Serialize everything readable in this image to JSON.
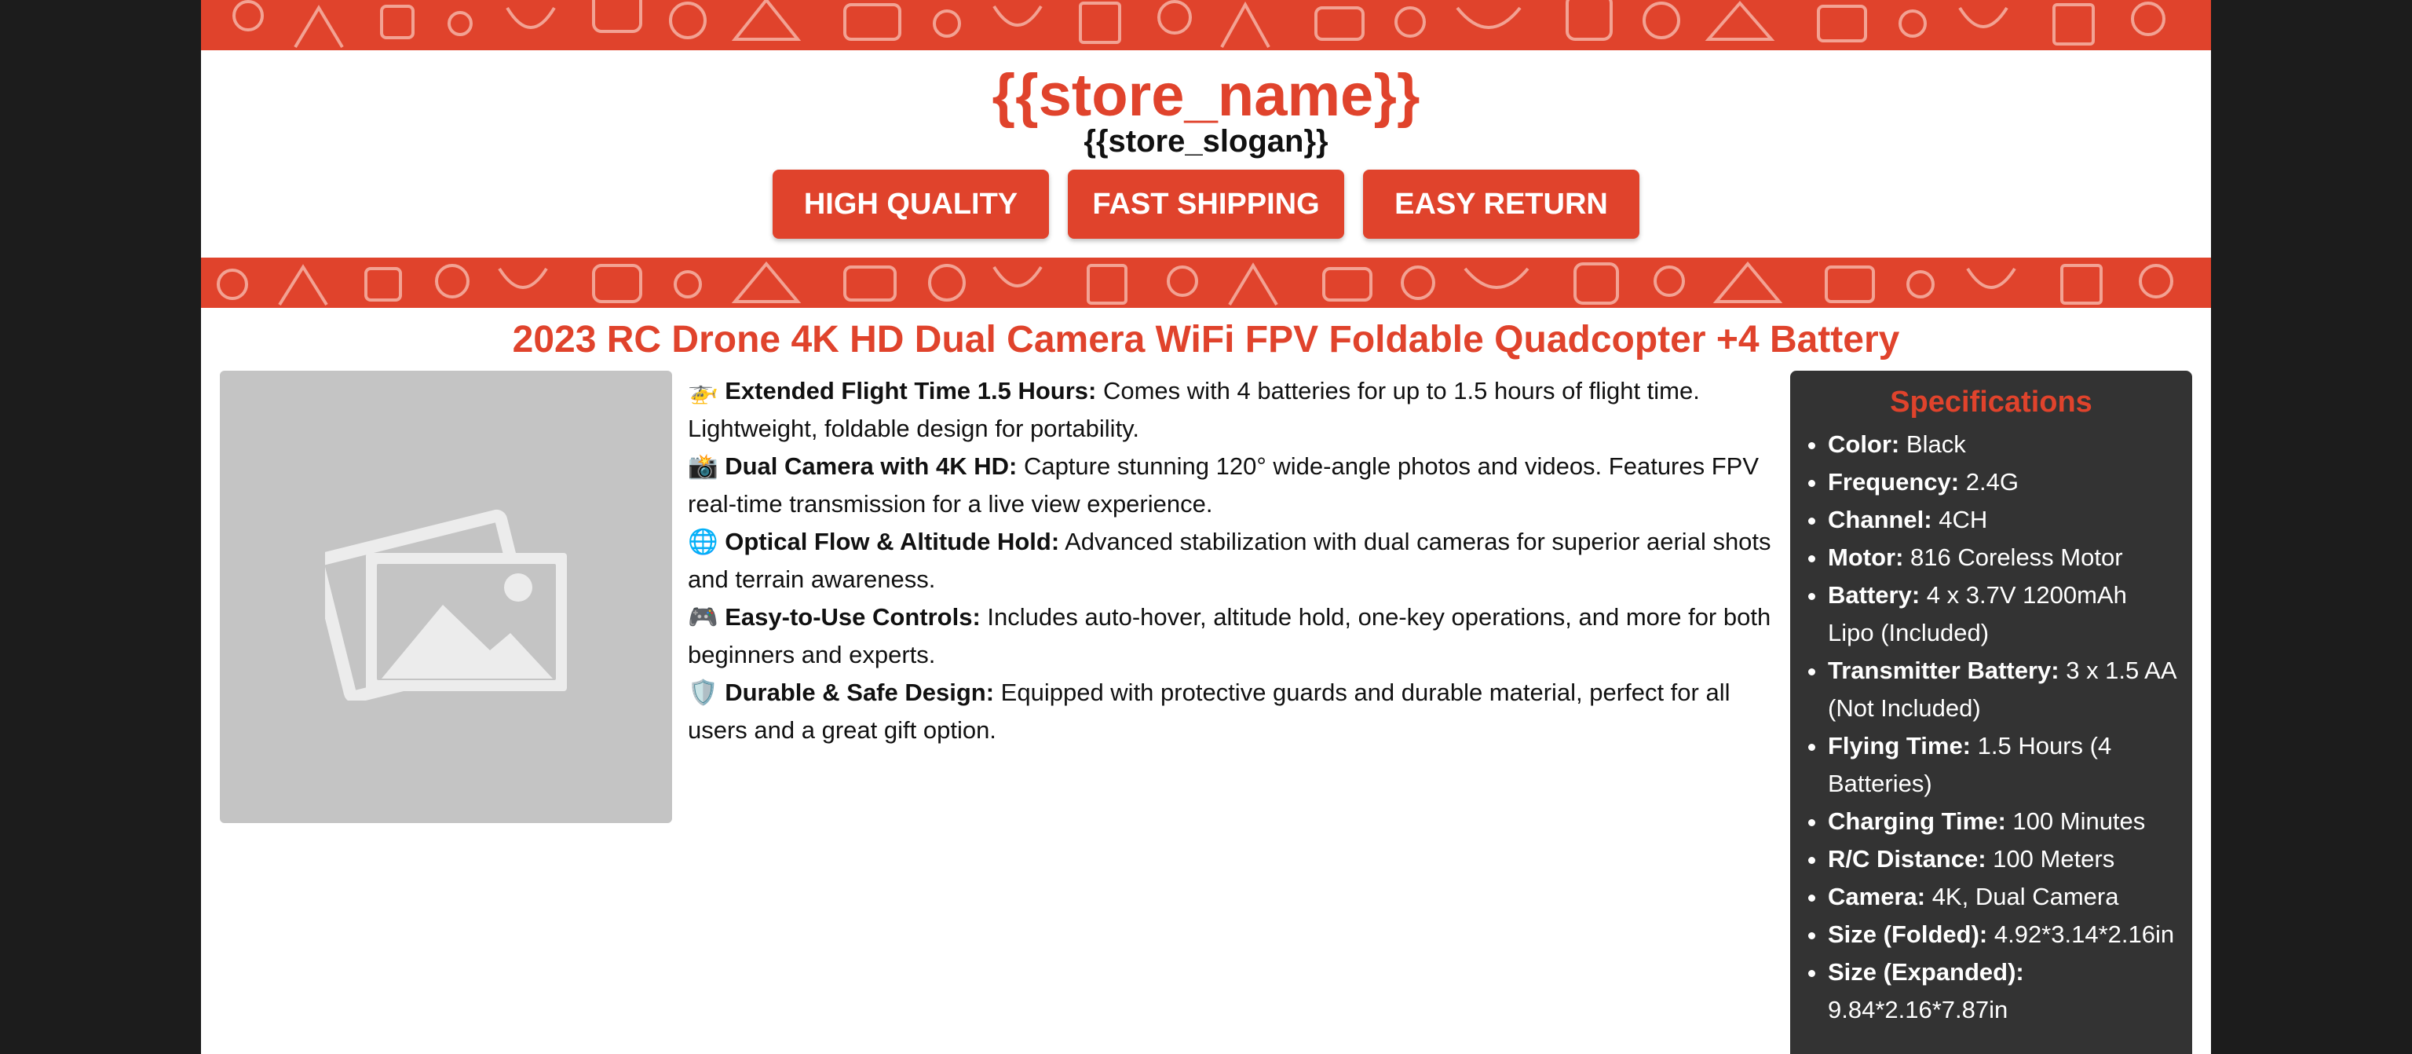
{
  "header": {
    "store_name": "{{store_name}}",
    "store_slogan": "{{store_slogan}}"
  },
  "badges": [
    "HIGH QUALITY",
    "FAST SHIPPING",
    "EASY RETURN"
  ],
  "product": {
    "title": "2023 RC Drone 4K HD Dual Camera WiFi FPV Foldable Quadcopter +4 Battery"
  },
  "features": [
    {
      "icon": "🚁",
      "title": "Extended Flight Time 1.5 Hours:",
      "text": "Comes with 4 batteries for up to 1.5 hours of flight time. Lightweight, foldable design for portability."
    },
    {
      "icon": "📸",
      "title": "Dual Camera with 4K HD:",
      "text": "Capture stunning 120° wide-angle photos and videos. Features FPV real-time transmission for a live view experience."
    },
    {
      "icon": "🌐",
      "title": "Optical Flow & Altitude Hold:",
      "text": "Advanced stabilization with dual cameras for superior aerial shots and terrain awareness."
    },
    {
      "icon": "🎮",
      "title": "Easy-to-Use Controls:",
      "text": "Includes auto-hover, altitude hold, one-key operations, and more for both beginners and experts."
    },
    {
      "icon": "🛡️",
      "title": "Durable & Safe Design:",
      "text": "Equipped with protective guards and durable material, perfect for all users and a great gift option."
    }
  ],
  "specs": {
    "title": "Specifications",
    "items": [
      {
        "label": "Color:",
        "value": "Black"
      },
      {
        "label": "Frequency:",
        "value": "2.4G"
      },
      {
        "label": "Channel:",
        "value": "4CH"
      },
      {
        "label": "Motor:",
        "value": "816 Coreless Motor"
      },
      {
        "label": "Battery:",
        "value": "4 x 3.7V 1200mAh Lipo (Included)"
      },
      {
        "label": "Transmitter Battery:",
        "value": "3 x 1.5 AA (Not Included)"
      },
      {
        "label": "Flying Time:",
        "value": "1.5 Hours (4 Batteries)"
      },
      {
        "label": "Charging Time:",
        "value": "100 Minutes"
      },
      {
        "label": "R/C Distance:",
        "value": "100 Meters"
      },
      {
        "label": "Camera:",
        "value": "4K, Dual Camera"
      },
      {
        "label": "Size (Folded):",
        "value": "4.92*3.14*2.16in"
      },
      {
        "label": "Size (Expanded):",
        "value": "9.84*2.16*7.87in"
      }
    ]
  },
  "colors": {
    "accent": "#e0432c",
    "spec_panel": "#333333",
    "image_placeholder": "#c4c4c4",
    "outer_background": "#1c1c1c"
  }
}
